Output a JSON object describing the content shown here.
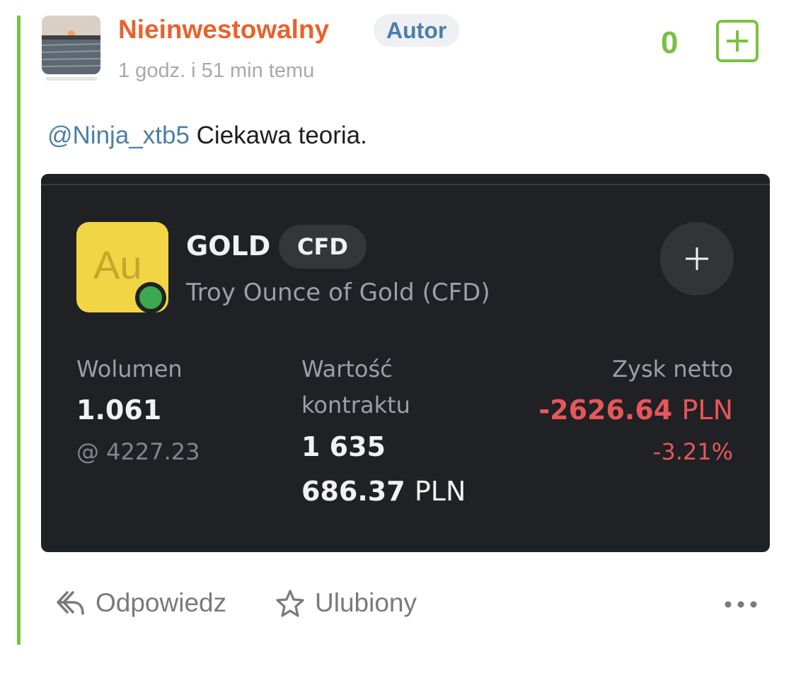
{
  "post": {
    "author": "Nieinwestowalny",
    "author_badge": "Autor",
    "time": "1 godz. i 51 min temu",
    "score": "0",
    "mention": "@Ninja_xtb5",
    "text": " Ciekawa teoria.",
    "colors": {
      "author": "#e8632b",
      "accent": "#7ac142",
      "link": "#4b7fa8"
    }
  },
  "trade_card": {
    "symbol_icon_text": "Au",
    "symbol": "GOLD",
    "type_badge": "CFD",
    "description": "Troy Ounce of Gold (CFD)",
    "volume_label": "Wolumen",
    "volume_value": "1.061",
    "volume_price": "@ 4227.23",
    "contract_label_line1": "Wartość",
    "contract_label_line2": "kontraktu",
    "contract_value_line1": "1 635",
    "contract_value_line2": "686.37",
    "contract_unit": "PLN",
    "profit_label": "Zysk netto",
    "profit_value": "-2626.64",
    "profit_unit": "PLN",
    "profit_percent": "-3.21%",
    "colors": {
      "background": "#202124",
      "negative": "#e5575b",
      "icon_tile": "#f2d544",
      "status_dot": "#3da84f"
    }
  },
  "actions": {
    "reply": "Odpowiedz",
    "favorite": "Ulubiony"
  }
}
